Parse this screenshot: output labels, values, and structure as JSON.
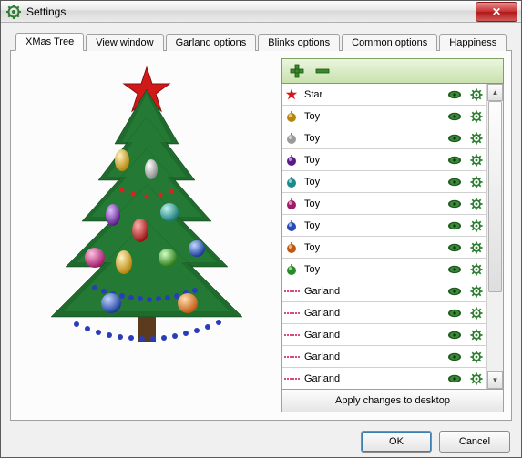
{
  "window": {
    "title": "Settings"
  },
  "tabs": [
    "XMas Tree",
    "View window",
    "Garland options",
    "Blinks options",
    "Common options",
    "Happiness"
  ],
  "decor_list": [
    {
      "icon": "star",
      "color": "#d11919",
      "label": "Star"
    },
    {
      "icon": "ball",
      "color": "#b8860b",
      "label": "Toy"
    },
    {
      "icon": "ball",
      "color": "#9a9a9a",
      "label": "Toy"
    },
    {
      "icon": "ball",
      "color": "#5a1a8a",
      "label": "Toy"
    },
    {
      "icon": "ball",
      "color": "#1a8a8a",
      "label": "Toy"
    },
    {
      "icon": "ball",
      "color": "#a01a6a",
      "label": "Toy"
    },
    {
      "icon": "ball",
      "color": "#2a4aba",
      "label": "Toy"
    },
    {
      "icon": "ball",
      "color": "#c05a10",
      "label": "Toy"
    },
    {
      "icon": "ball",
      "color": "#2a8a2a",
      "label": "Toy"
    },
    {
      "icon": "garland",
      "color": "#d01050",
      "label": "Garland"
    },
    {
      "icon": "garland",
      "color": "#d01050",
      "label": "Garland"
    },
    {
      "icon": "garland",
      "color": "#d01050",
      "label": "Garland"
    },
    {
      "icon": "garland",
      "color": "#d01050",
      "label": "Garland"
    },
    {
      "icon": "garland",
      "color": "#d01050",
      "label": "Garland"
    }
  ],
  "buttons": {
    "apply": "Apply changes to desktop",
    "ok": "OK",
    "cancel": "Cancel"
  }
}
